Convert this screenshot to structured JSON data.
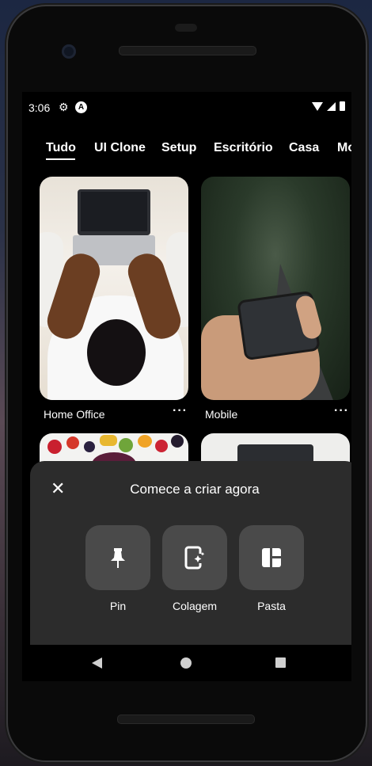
{
  "status_bar": {
    "time": "3:06"
  },
  "tabs": [
    "Tudo",
    "UI Clone",
    "Setup",
    "Escritório",
    "Casa",
    "Mo"
  ],
  "pins": [
    {
      "label": "Home Office",
      "more": "···"
    },
    {
      "label": "Mobile",
      "more": "···"
    }
  ],
  "sheet": {
    "title": "Comece a criar agora",
    "close": "✕",
    "actions": [
      {
        "label": "Pin",
        "icon": "pin-icon"
      },
      {
        "label": "Colagem",
        "icon": "collage-icon"
      },
      {
        "label": "Pasta",
        "icon": "board-icon"
      }
    ]
  }
}
